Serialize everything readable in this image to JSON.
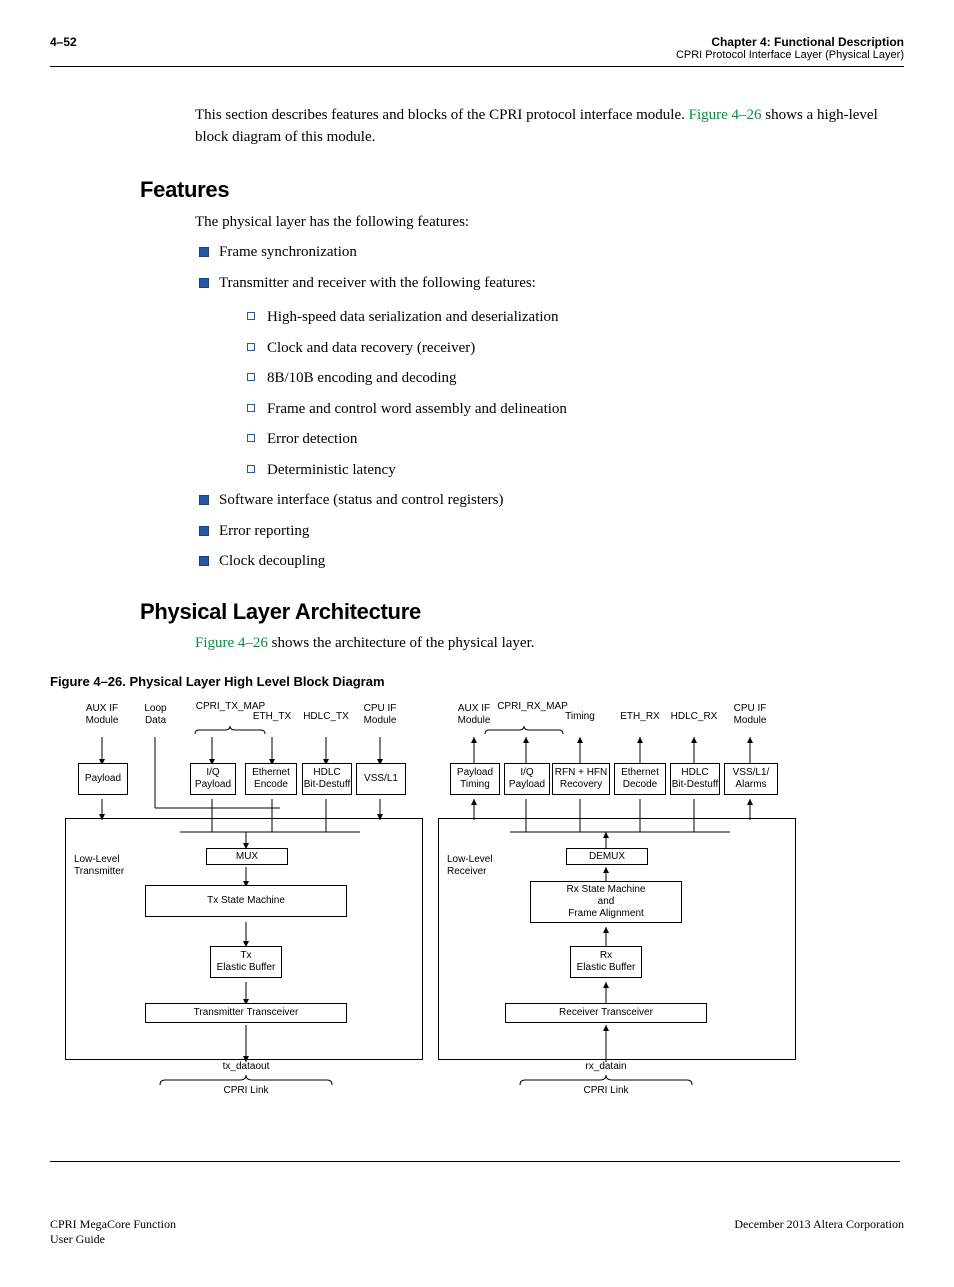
{
  "header": {
    "page_num": "4–52",
    "chapter": "Chapter 4:   Functional Description",
    "section": "CPRI Protocol Interface Layer (Physical Layer)"
  },
  "intro": {
    "p1_a": "This section describes features and blocks of the CPRI protocol interface module. ",
    "link1": "Figure 4–26",
    "p1_b": " shows a high-level block diagram of this module."
  },
  "features": {
    "heading": "Features",
    "intro": "The physical layer has the following features:",
    "items": [
      "Frame synchronization",
      "Transmitter and receiver with the following features:",
      "Software interface (status and control registers)",
      "Error reporting",
      "Clock decoupling"
    ],
    "sub": [
      "High-speed data serialization and deserialization",
      "Clock and data recovery (receiver)",
      "8B/10B encoding and decoding",
      "Frame and control word assembly and delineation",
      "Error detection",
      "Deterministic latency"
    ]
  },
  "arch": {
    "heading": "Physical Layer Architecture",
    "link": "Figure 4–26",
    "text": " shows the architecture of the physical layer.",
    "figure_title": "Figure 4–26.  Physical Layer High Level Block Diagram"
  },
  "diagram": {
    "top_labels_tx": [
      "AUX IF\nModule",
      "Loop\nData",
      "CPRI_TX_MAP",
      "ETH_TX",
      "HDLC_TX",
      "CPU IF\nModule"
    ],
    "top_labels_rx": [
      "AUX IF\nModule",
      "CPRI_RX_MAP",
      "Timing",
      "ETH_RX",
      "HDLC_RX",
      "CPU IF\nModule"
    ],
    "tx_boxes": [
      "Payload",
      "I/Q\nPayload",
      "Ethernet\nEncode",
      "HDLC\nBit-Destuff",
      "VSS/L1"
    ],
    "rx_boxes": [
      "Payload\nTiming",
      "I/Q\nPayload",
      "RFN + HFN\nRecovery",
      "Ethernet\nDecode",
      "HDLC\nBit-Destuff",
      "VSS/L1/\nAlarms"
    ],
    "tx_big": "Low-Level\nTransmitter",
    "rx_big": "Low-Level\nReceiver",
    "mux": "MUX",
    "demux": "DEMUX",
    "tx_sm": "Tx State Machine",
    "rx_sm": "Rx State Machine\nand\nFrame Alignment",
    "tx_eb": "Tx\nElastic Buffer",
    "rx_eb": "Rx\nElastic Buffer",
    "tx_tr": "Transmitter Transceiver",
    "rx_tr": "Receiver Transceiver",
    "tx_out": "tx_dataout",
    "rx_in": "rx_datain",
    "cpri_link": "CPRI Link"
  },
  "footer": {
    "left1": "CPRI MegaCore Function",
    "left2": "User Guide",
    "right": "December 2013   Altera Corporation"
  }
}
